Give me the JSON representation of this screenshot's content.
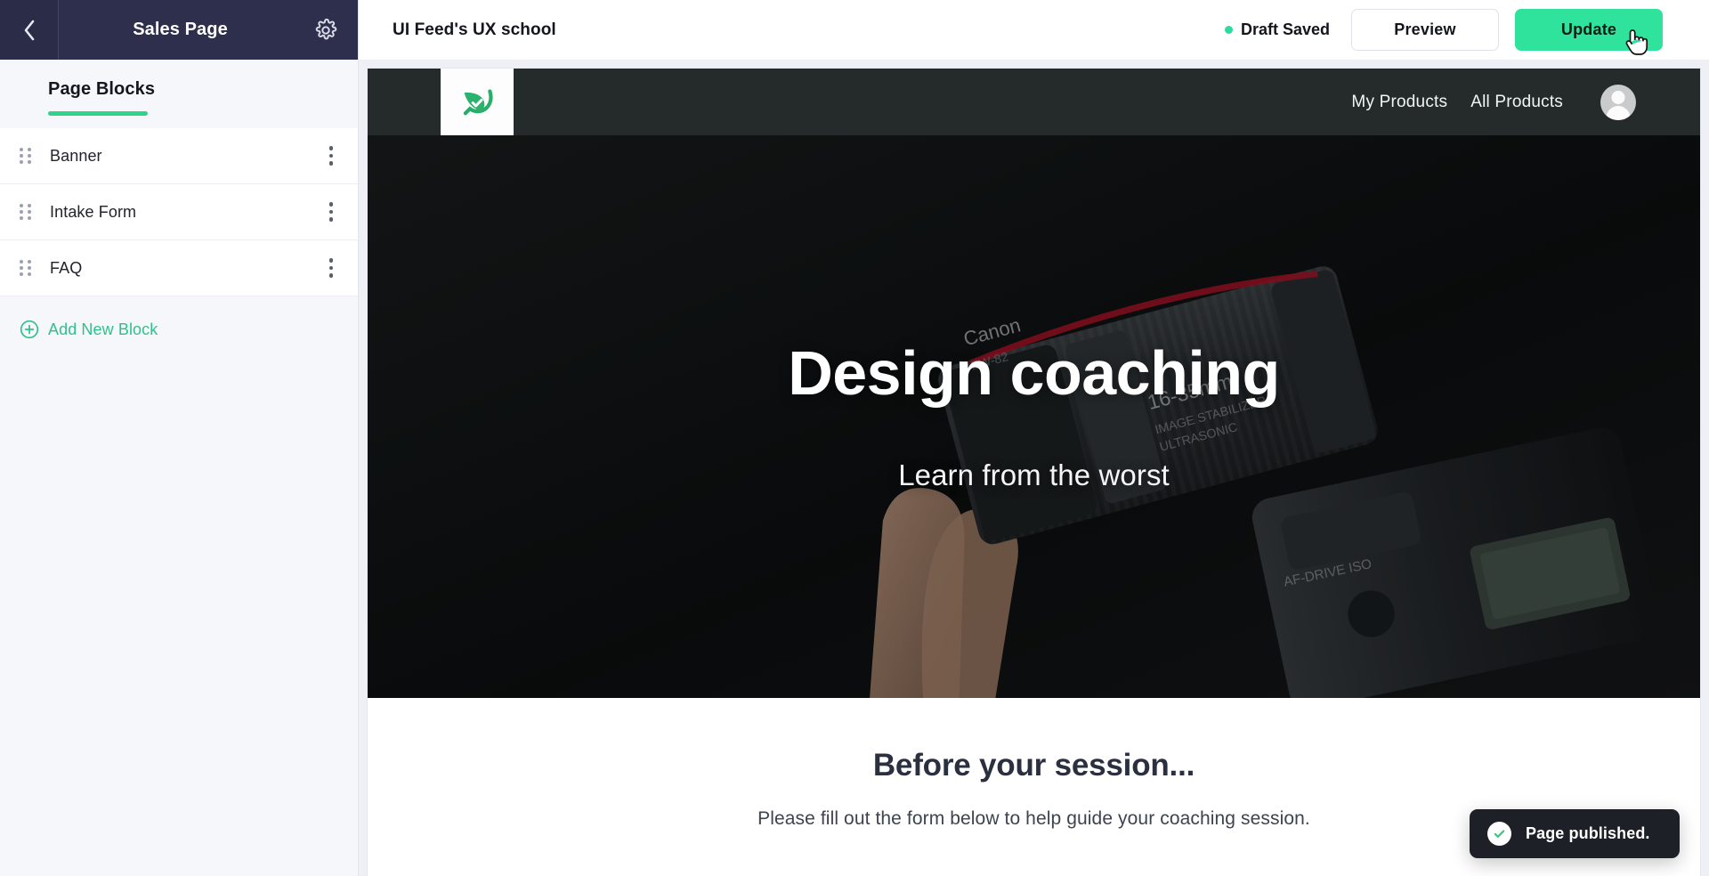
{
  "sidebar": {
    "back_icon": "chevron-left-icon",
    "title": "Sales Page",
    "gear_icon": "gear-icon",
    "tab": {
      "label": "Page Blocks"
    },
    "blocks": [
      {
        "label": "Banner",
        "drag_icon": "drag-handle-icon",
        "menu_icon": "more-vertical-icon"
      },
      {
        "label": "Intake Form",
        "drag_icon": "drag-handle-icon",
        "menu_icon": "more-vertical-icon"
      },
      {
        "label": "FAQ",
        "drag_icon": "drag-handle-icon",
        "menu_icon": "more-vertical-icon"
      }
    ],
    "add_block": {
      "label": "Add New Block",
      "icon": "plus-circle-icon"
    }
  },
  "topbar": {
    "title": "UI Feed's UX school",
    "status": {
      "label": "Draft Saved",
      "dot_color": "#2fd9a0"
    },
    "preview_label": "Preview",
    "update_label": "Update"
  },
  "preview": {
    "nav": {
      "logo_icon": "leaf-check-logo",
      "links": [
        "My Products",
        "All Products"
      ],
      "avatar_icon": "user-avatar-icon"
    },
    "hero": {
      "title": "Design coaching",
      "subtitle": "Learn from the worst"
    },
    "section": {
      "title": "Before your session...",
      "subtitle": "Please fill out the form below to help guide your coaching session."
    }
  },
  "toast": {
    "message": "Page published.",
    "icon": "check-circle-icon"
  },
  "colors": {
    "accent_green": "#2fd48a",
    "update_green": "#2fe39c",
    "sidebar_header": "#2e2f4c",
    "site_nav_dark": "#242b2a"
  }
}
